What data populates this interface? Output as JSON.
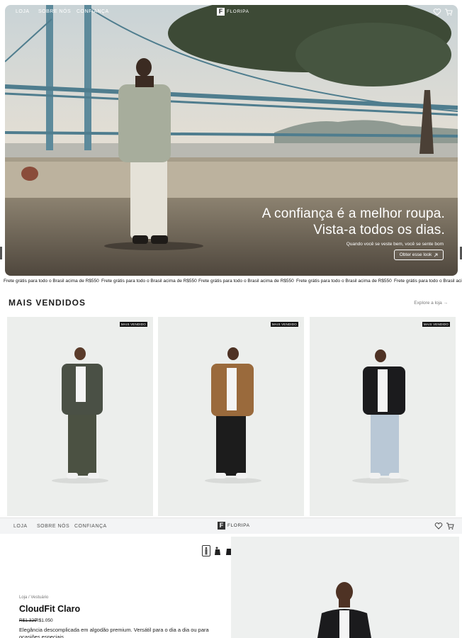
{
  "hero": {
    "nav": {
      "loja": "LOJA",
      "sobre": "SOBRE NÓS",
      "confianca": "CONFIANÇA"
    },
    "brand": "FLORIPA",
    "brand_letter": "F",
    "headline_line1": "A confiança é a melhor roupa.",
    "headline_line2": "Vista-a todos os dias.",
    "subtext": "Quando você se veste bem, você se sente bom",
    "cta_label": "Obter esse look",
    "icons": [
      "heart-icon",
      "cart-icon",
      "arrow-up-right-icon"
    ]
  },
  "ticker": {
    "message": "Frete grátis para todo o Brasil acima de R$550"
  },
  "best_sellers": {
    "title": "MAIS VENDIDOS",
    "explore_label": "Explore a loja",
    "explore_arrow": "→",
    "badge": "MAIS VENDIDO",
    "products": [
      {
        "jacket_color": "#4a5045",
        "pants_color": "#4b5142"
      },
      {
        "jacket_color": "#9a6a3c",
        "pants_color": "#1c1c1c"
      },
      {
        "jacket_color": "#1b1b1d",
        "pants_color": "#b9c8d6"
      }
    ]
  },
  "sub_header": {
    "loja": "LOJA",
    "sobre": "SOBRE NÓS",
    "confianca": "CONFIANÇA",
    "brand": "FLORIPA",
    "brand_letter": "F"
  },
  "product": {
    "breadcrumb": "Loja / Vestuário",
    "name": "CloudFit Claro",
    "price_old": "R$1.320",
    "price_new": "R$1.050",
    "description": "Elegância descomplicada em algodão premium. Versátil para o dia a dia ou para ocasiões especiais."
  },
  "colors": {
    "card_bg": "#eceeec",
    "badge_bg": "#111111",
    "accent_dark": "#1a1a1a"
  }
}
